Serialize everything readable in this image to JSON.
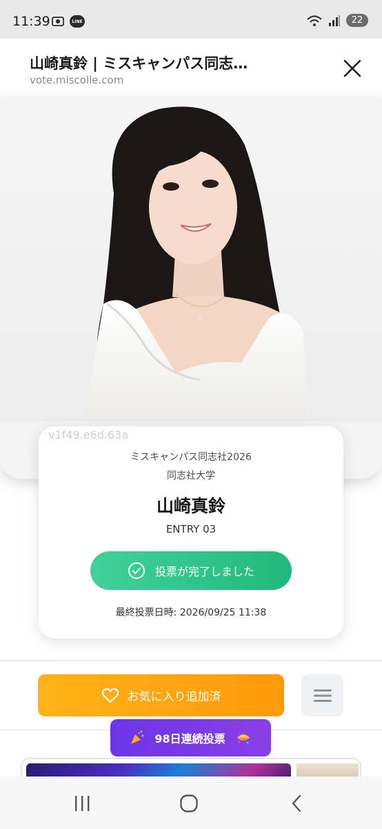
{
  "status_bar": {
    "time": "11:39",
    "line_label": "LINE",
    "battery": "22",
    "icons": [
      "screenshot-icon",
      "line-icon",
      "wifi-icon",
      "signal-icon",
      "battery-icon"
    ]
  },
  "browser": {
    "title": "山崎真鈴 | ミスキャンパス同志…",
    "url": "vote.miscolle.com"
  },
  "hero": {
    "watermark": "v1f49.e6d.63a"
  },
  "profile": {
    "contest": "ミスキャンパス同志社2026",
    "university": "同志社大学",
    "name": "山崎真鈴",
    "entry": "ENTRY 03",
    "vote_done_label": "投票が完了しました",
    "last_vote": "最終投票日時: 2026/09/25 11:38"
  },
  "actions": {
    "favorite_label": "お気に入り追加済",
    "streak_label": "98日連続投票"
  },
  "colors": {
    "vote_green": "#2dc58a",
    "favorite_orange": "#ffa510",
    "streak_purple": "#7a39e7"
  }
}
